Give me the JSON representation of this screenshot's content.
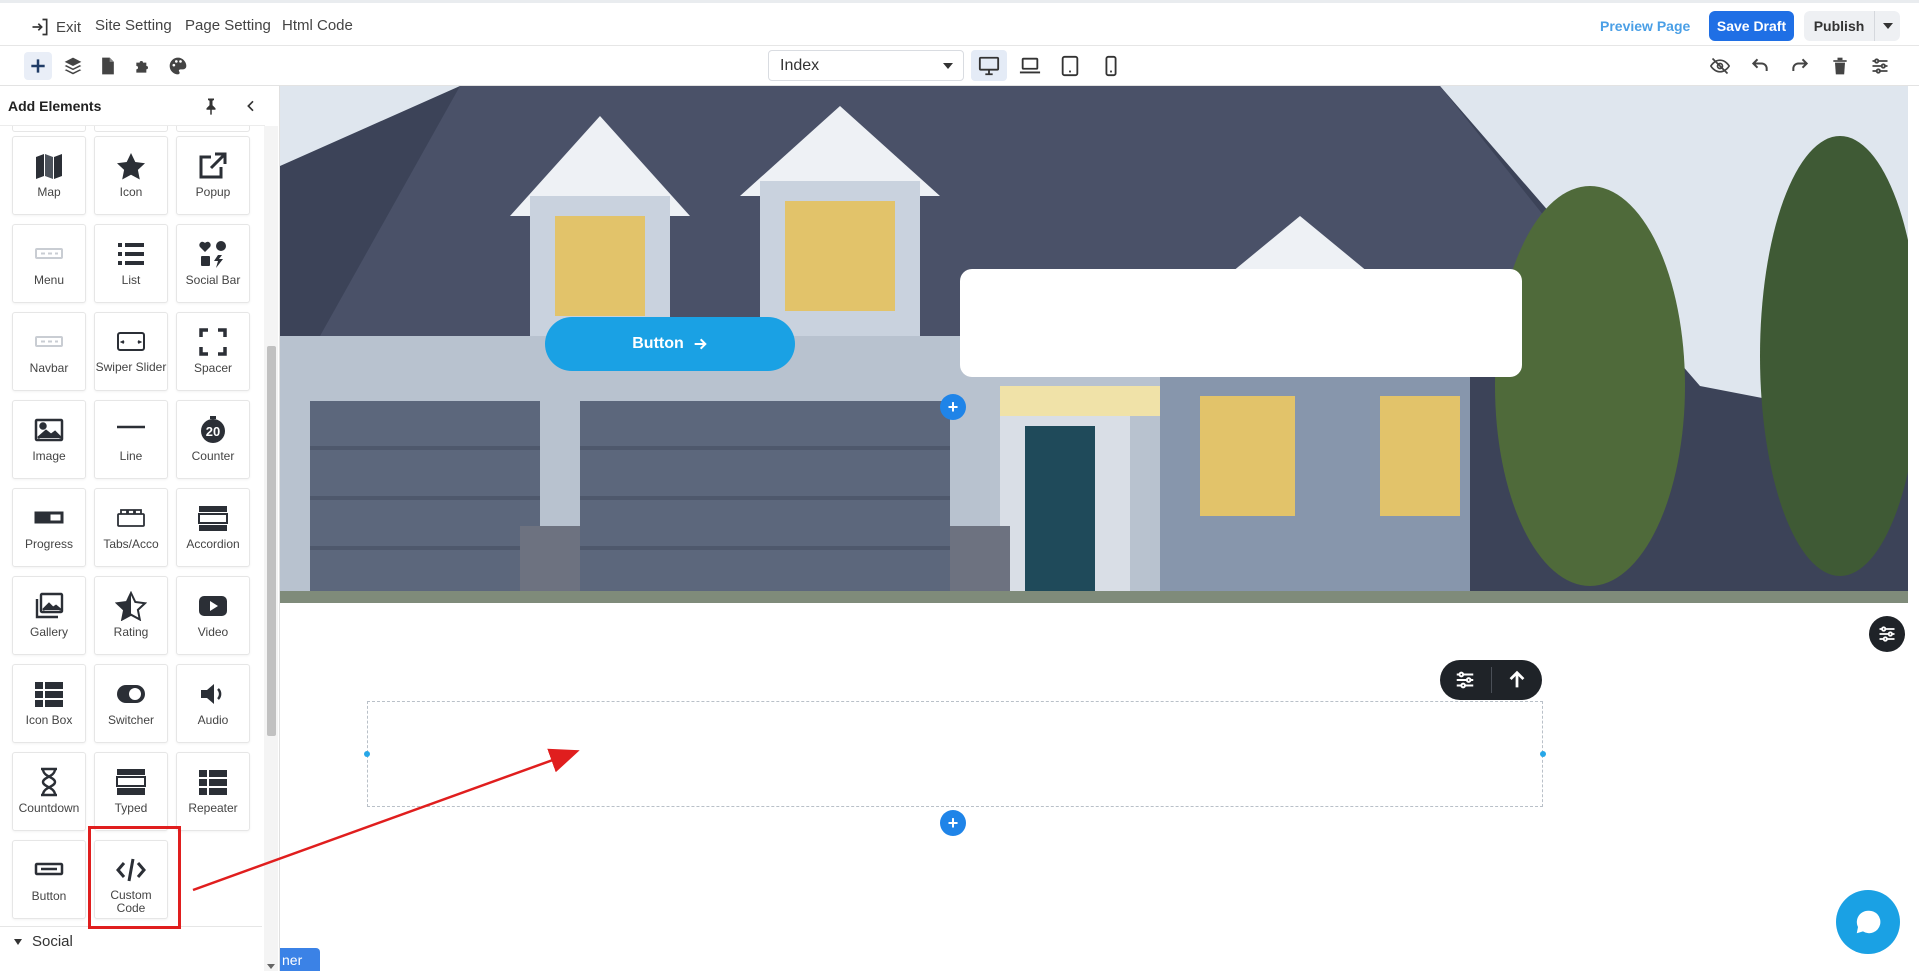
{
  "topbar": {
    "exit_label": "Exit",
    "site_setting_label": "Site Setting",
    "page_setting_label": "Page Setting",
    "html_code_label": "Html Code",
    "preview_label": "Preview Page",
    "save_draft_label": "Save Draft",
    "publish_label": "Publish"
  },
  "toolbar": {
    "tools": [
      "plus-icon",
      "layers-icon",
      "page-icon",
      "puzzle-icon",
      "palette-icon"
    ],
    "page_select_value": "Index",
    "devices": [
      "desktop-icon",
      "laptop-icon",
      "tablet-icon",
      "mobile-icon"
    ],
    "active_device": "desktop",
    "right_tools": [
      "eye-off-icon",
      "undo-icon",
      "redo-icon",
      "trash-icon",
      "sliders-icon"
    ]
  },
  "panel": {
    "title": "Add Elements",
    "social_label": "Social",
    "tiles": [
      {
        "label": "Map",
        "icon": "map-icon"
      },
      {
        "label": "Icon",
        "icon": "star-icon"
      },
      {
        "label": "Popup",
        "icon": "external-link-icon"
      },
      {
        "label": "Menu",
        "icon": "menu-icon"
      },
      {
        "label": "List",
        "icon": "list-icon"
      },
      {
        "label": "Social Bar",
        "icon": "social-bar-icon"
      },
      {
        "label": "Navbar",
        "icon": "navbar-icon"
      },
      {
        "label": "Swiper Slider",
        "icon": "swiper-icon"
      },
      {
        "label": "Spacer",
        "icon": "spacer-icon"
      },
      {
        "label": "Image",
        "icon": "image-icon"
      },
      {
        "label": "Line",
        "icon": "line-icon"
      },
      {
        "label": "Counter",
        "icon": "counter-icon"
      },
      {
        "label": "Progress",
        "icon": "progress-icon"
      },
      {
        "label": "Tabs/Acco",
        "icon": "tabs-icon"
      },
      {
        "label": "Accordion",
        "icon": "accordion-icon"
      },
      {
        "label": "Gallery",
        "icon": "gallery-icon"
      },
      {
        "label": "Rating",
        "icon": "rating-icon"
      },
      {
        "label": "Video",
        "icon": "video-icon"
      },
      {
        "label": "Icon Box",
        "icon": "icon-box-icon"
      },
      {
        "label": "Switcher",
        "icon": "toggle-icon"
      },
      {
        "label": "Audio",
        "icon": "audio-icon"
      },
      {
        "label": "Countdown",
        "icon": "hourglass-icon"
      },
      {
        "label": "Typed",
        "icon": "typed-icon"
      },
      {
        "label": "Repeater",
        "icon": "repeater-icon"
      },
      {
        "label": "Button",
        "icon": "button-icon"
      },
      {
        "label": "Custom Code",
        "icon": "code-icon"
      }
    ],
    "counter_number": "20"
  },
  "canvas": {
    "hero_button_label": "Button",
    "bottom_tag_label": "ner",
    "colors": {
      "accent": "#1f84e8",
      "hero_button": "#1aa1e4",
      "highlight": "#e01e1e",
      "dark": "#1f2328"
    }
  }
}
